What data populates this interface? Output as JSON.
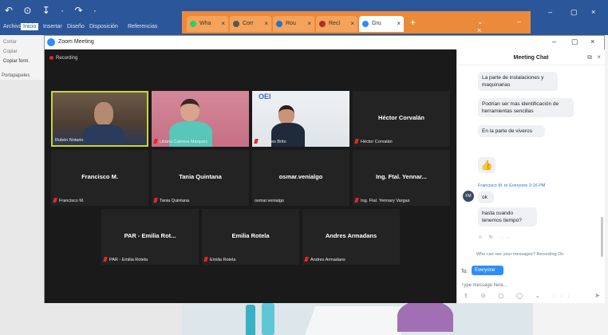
{
  "word": {
    "quick_access": "↶ ⊙ ↧ · ↷ ·",
    "tabs": [
      "Archivo",
      "Inicio",
      "Insertar",
      "Diseño",
      "Disposición",
      "Referencias"
    ],
    "ribbon_items": [
      "Cortar",
      "Copiar",
      "Copiar form."
    ],
    "section_label": "Portapapeles"
  },
  "browser": {
    "tabs": [
      {
        "label": "Wha",
        "color": "#25d366"
      },
      {
        "label": "Corr",
        "color": "#555555"
      },
      {
        "label": "Rou",
        "color": "#2d6fd3"
      },
      {
        "label": "Recl",
        "color": "#b0302b"
      },
      {
        "label": "Gru",
        "color": "#2d8cff"
      }
    ],
    "close_glyph": "×",
    "new_tab": "+",
    "controls": "⌄ – ▢ ×",
    "outer_controls": [
      "–",
      "▢",
      "×"
    ]
  },
  "zoom": {
    "window_title": "Zoom Meeting",
    "window_controls": [
      "–",
      "▢",
      "×"
    ],
    "recording": "Recording",
    "participants": [
      {
        "display": "",
        "label": "Rubén Notario",
        "video": "vid1",
        "active": true,
        "muted": false
      },
      {
        "display": "",
        "label": "Liliana Cabrera Márquez",
        "video": "vid2",
        "active": false,
        "muted": true
      },
      {
        "display": "",
        "label": "Lourdes Brito",
        "video": "vid3",
        "active": false,
        "muted": true,
        "sign": "OEI"
      },
      {
        "display": "Héctor Corvalán",
        "label": "Héctor Corvalán",
        "video": "",
        "active": false,
        "muted": true
      },
      {
        "display": "Francisco M.",
        "label": "Francisco M.",
        "video": "",
        "active": false,
        "muted": true
      },
      {
        "display": "Tania Quintana",
        "label": "Tania Quintana",
        "video": "",
        "active": false,
        "muted": true
      },
      {
        "display": "osmar.venialgo",
        "label": "osmar.venialgo",
        "video": "",
        "active": false,
        "muted": false
      },
      {
        "display": "Ing. Ftal. Yennar...",
        "label": "Ing. Ftal. Yennary Vargas",
        "video": "",
        "active": false,
        "muted": true
      },
      {
        "display": "PAR - Emilia Rot...",
        "label": "PAR - Emilia Rotela",
        "video": "",
        "active": false,
        "muted": true
      },
      {
        "display": "Emilia Rotela",
        "label": "Emilia Rotela",
        "video": "",
        "active": false,
        "muted": true
      },
      {
        "display": "Andres Armadans",
        "label": "Andres Armadans",
        "video": "",
        "active": false,
        "muted": true
      }
    ]
  },
  "chat": {
    "title": "Meeting Chat",
    "popout_icon": "⧉",
    "close_icon": "×",
    "messages": [
      "La parte de instalaciones y maquinarias",
      "Podrían ser más identificación de herramientas sencillas",
      "En la parte de viveros"
    ],
    "thumbs": "👍",
    "sender": "Francisco M. to Everyone 3:16 PM",
    "avatar_initials": "FM",
    "reply_messages": [
      "ok",
      "hasta cuando tenemos tiempo?"
    ],
    "reactions": "☺ ↻ ···",
    "who_can_see": "Who can see your messages? Recording On",
    "to_label": "To:",
    "recipient": "Everyone ⌄",
    "input_placeholder": "Type message here...",
    "tools": "⇪ ⊙ ▢ ◯ ⌄ ···",
    "send": "➤"
  }
}
